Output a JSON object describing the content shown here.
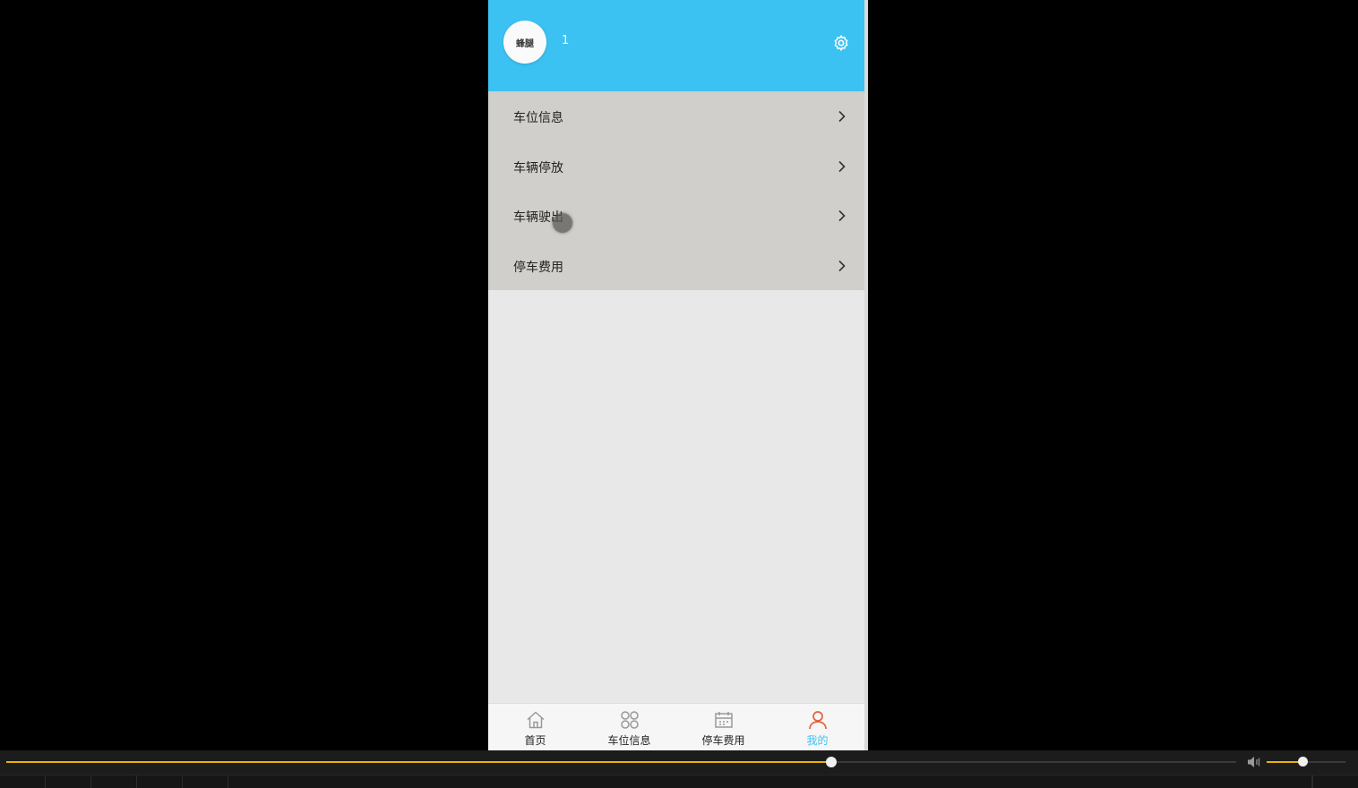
{
  "header": {
    "avatar_text": "蜂腿",
    "username": "1",
    "background": "#3cc2f2"
  },
  "menu": {
    "items": [
      {
        "label": "车位信息"
      },
      {
        "label": "车辆停放"
      },
      {
        "label": "车辆驶出"
      },
      {
        "label": "停车费用"
      }
    ]
  },
  "tabbar": {
    "items": [
      {
        "label": "首页",
        "icon": "home-icon"
      },
      {
        "label": "车位信息",
        "icon": "grid-icon"
      },
      {
        "label": "停车费用",
        "icon": "calendar-icon"
      },
      {
        "label": "我的",
        "icon": "user-icon",
        "active": true
      }
    ],
    "active_color": "#3cc2f2"
  },
  "player": {
    "progress_fraction": 0.671,
    "volume_fraction": 0.45,
    "accent_color": "#e8b400"
  }
}
